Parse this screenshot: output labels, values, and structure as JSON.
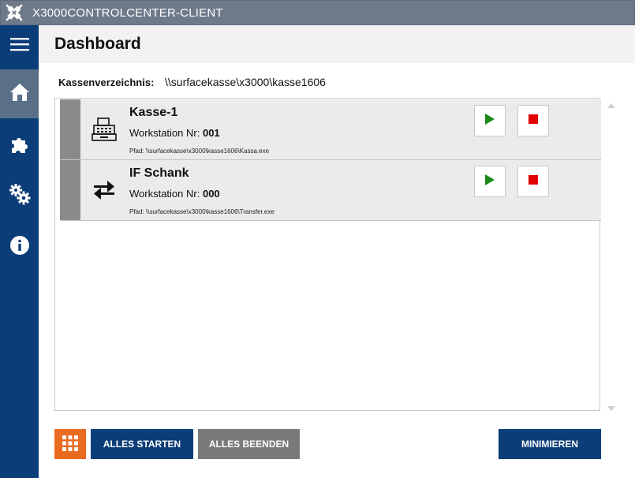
{
  "window": {
    "title": "X3000CONTROLCENTER-CLIENT"
  },
  "sidebar": {
    "items": [
      {
        "icon": "hamburger-menu-icon",
        "active": false
      },
      {
        "icon": "home-icon",
        "active": true
      },
      {
        "icon": "puzzle-icon",
        "active": false
      },
      {
        "icon": "gears-icon",
        "active": false
      },
      {
        "icon": "info-icon",
        "active": false
      }
    ]
  },
  "header": {
    "title": "Dashboard"
  },
  "directory": {
    "label": "Kassenverzeichnis:",
    "value": "\\\\surfacekasse\\x3000\\kasse1606"
  },
  "entries": [
    {
      "name": "Kasse-1",
      "icon": "cash-register-icon",
      "workstation_label": "Workstation Nr:",
      "workstation_nr": "001",
      "path_label": "Pfad:",
      "path": "\\\\surfacekasse\\x3000\\kasse1606\\Kassa.exe"
    },
    {
      "name": "IF Schank",
      "icon": "transfer-arrows-icon",
      "workstation_label": "Workstation Nr:",
      "workstation_nr": "000",
      "path_label": "Pfad:",
      "path": "\\\\surfacekasse\\x3000\\kasse1606\\Transfer.exe"
    }
  ],
  "buttons": {
    "start_all": "ALLES STARTEN",
    "stop_all": "ALLES BEENDEN",
    "minimize": "MINIMIEREN"
  },
  "colors": {
    "sidebar": "#0b3d78",
    "sidebar_active": "#5a6f88",
    "primary_button": "#0b3d78",
    "secondary_button": "#7a7a7a",
    "grid_button": "#ea6a1f",
    "play": "#1a8a1a",
    "stop": "#e00000"
  }
}
